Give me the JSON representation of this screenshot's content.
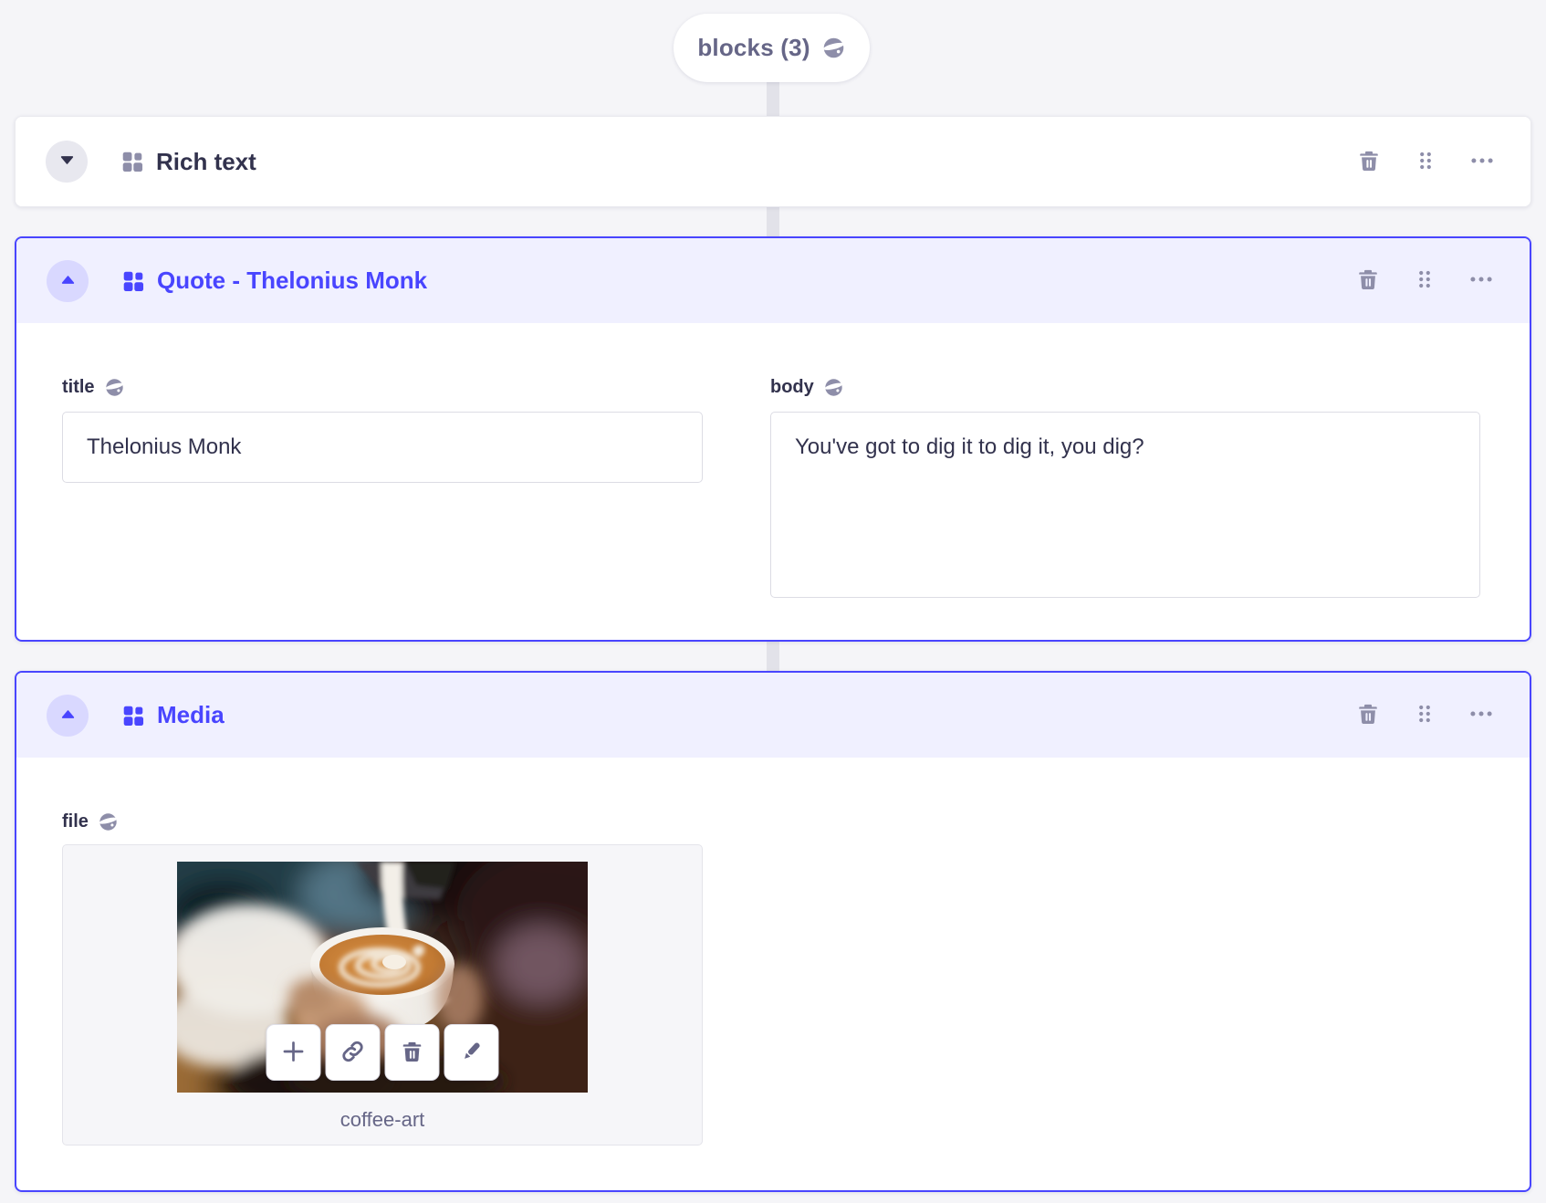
{
  "array_field": {
    "label": "blocks (3)"
  },
  "blocks": [
    {
      "title": "Rich text",
      "state": "collapsed"
    },
    {
      "title": "Quote - Thelonius Monk",
      "state": "expanded"
    },
    {
      "title": "Media",
      "state": "expanded"
    }
  ],
  "quote_block": {
    "title_field": {
      "label": "title",
      "value": "Thelonius Monk",
      "localized": true
    },
    "body_field": {
      "label": "body",
      "value": "You've got to dig it to dig it, you dig?",
      "localized": true
    }
  },
  "media_block": {
    "file_field": {
      "label": "file",
      "filename": "coffee-art",
      "localized": true
    }
  },
  "colors": {
    "accent": "#4945ff",
    "accent_light": "#f0f0ff",
    "page_bg": "#f5f5f8"
  }
}
